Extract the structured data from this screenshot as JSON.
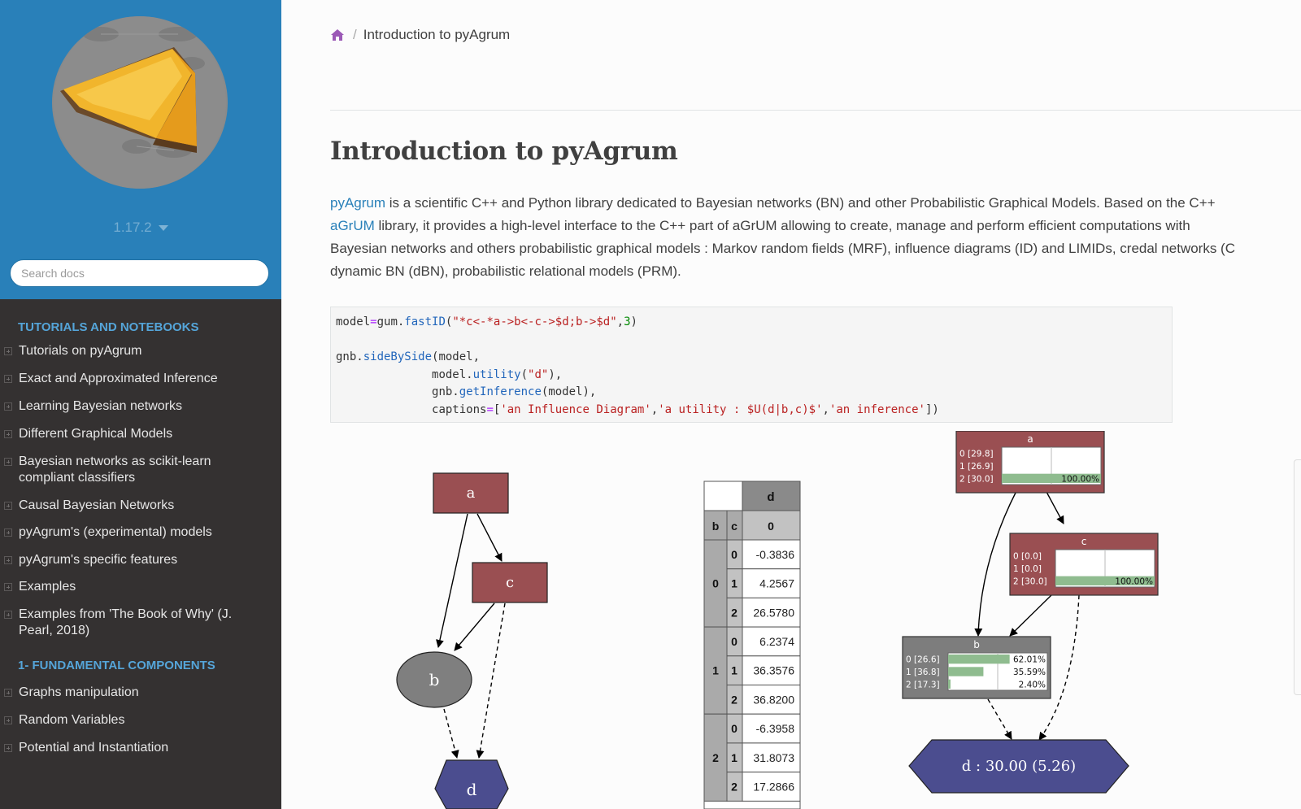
{
  "sidebar": {
    "version": "1.17.2",
    "search_placeholder": "Search docs",
    "captions": [
      "TUTORIALS AND NOTEBOOKS",
      "1- FUNDAMENTAL COMPONENTS"
    ],
    "section1": [
      "Tutorials on pyAgrum",
      "Exact and Approximated Inference",
      "Learning Bayesian networks",
      "Different Graphical Models",
      "Bayesian networks as scikit-learn compliant classifiers",
      "Causal Bayesian Networks",
      "pyAgrum's (experimental) models",
      "pyAgrum's specific features",
      "Examples",
      "Examples from 'The Book of Why' (J. Pearl, 2018)"
    ],
    "section2": [
      "Graphs manipulation",
      "Random Variables",
      "Potential and Instantiation"
    ]
  },
  "breadcrumb": {
    "current": "Introduction to pyAgrum"
  },
  "page": {
    "title": "Introduction to pyAgrum",
    "link_pyagrum": "pyAgrum",
    "text1": " is a scientific C++ and Python library dedicated to Bayesian networks (BN) and other Probabilistic Graphical Models. Based on the C++",
    "link_agrum": "aGrUM",
    "text2": " library, it provides a high-level interface to the C++ part of aGrUM allowing to create, manage and perform efficient computations with",
    "text3": "Bayesian networks and others probabilistic graphical models : Markov random fields (MRF), influence diagrams (ID) and LIMIDs, credal networks (C",
    "text4": "dynamic BN (dBN), probabilistic relational models (PRM)."
  },
  "code": {
    "l1_model": "model",
    "l1_eq": "=",
    "l1_gum": "gum.",
    "l1_fn": "fastID",
    "l1_open": "(",
    "l1_str": "\"*c<-*a->b<-c->$d;b->$d\"",
    "l1_comma": ",",
    "l1_num": "3",
    "l1_close": ")",
    "l2_gnb": "gnb.",
    "l2_fn": "sideBySide",
    "l2_rest": "(model,",
    "l3_model": "model.",
    "l3_fn": "utility",
    "l3_open": "(",
    "l3_str": "\"d\"",
    "l3_close": "),",
    "l4_gnb": "gnb.",
    "l4_fn": "getInference",
    "l4_rest": "(model),",
    "l5_cap": "captions",
    "l5_eq": "=",
    "l5_open": "[",
    "l5_s1": "'an Influence Diagram'",
    "l5_c1": ",",
    "l5_s2": "'a utility : $U(d|b,c)$'",
    "l5_c2": ",",
    "l5_s3": "'an inference'",
    "l5_close": "])"
  },
  "diagram": {
    "nodes": {
      "a": "a",
      "c": "c",
      "b": "b",
      "d": "d"
    }
  },
  "utility_table": {
    "col_header": "d",
    "col_value": "0",
    "row_headers": [
      "b",
      "c"
    ],
    "rows": [
      {
        "b": "0",
        "c": "0",
        "v": "-0.3836"
      },
      {
        "b": "",
        "c": "1",
        "v": "4.2567"
      },
      {
        "b": "",
        "c": "2",
        "v": "26.5780"
      },
      {
        "b": "1",
        "c": "0",
        "v": "6.2374"
      },
      {
        "b": "",
        "c": "1",
        "v": "36.3576"
      },
      {
        "b": "",
        "c": "2",
        "v": "36.8200"
      },
      {
        "b": "2",
        "c": "0",
        "v": "-6.3958"
      },
      {
        "b": "",
        "c": "1",
        "v": "31.8073"
      },
      {
        "b": "",
        "c": "2",
        "v": "17.2866"
      }
    ]
  },
  "inference": {
    "a": {
      "title": "a",
      "labels": [
        "0 [29.8]",
        "1 [26.9]",
        "2 [30.0]"
      ],
      "probs": [
        0,
        0,
        1.0
      ],
      "shown": [
        "",
        "",
        "100.00%"
      ]
    },
    "c": {
      "title": "c",
      "labels": [
        "0 [0.0]",
        "1 [0.0]",
        "2 [30.0]"
      ],
      "probs": [
        0,
        0,
        1.0
      ],
      "shown": [
        "",
        "",
        "100.00%"
      ]
    },
    "b": {
      "title": "b",
      "labels": [
        "0 [26.6]",
        "1 [36.8]",
        "2 [17.3]"
      ],
      "probs": [
        0.6201,
        0.3559,
        0.024
      ],
      "shown": [
        "62.01%",
        "35.59%",
        "2.40%"
      ]
    },
    "d": "d : 30.00 (5.26)"
  }
}
